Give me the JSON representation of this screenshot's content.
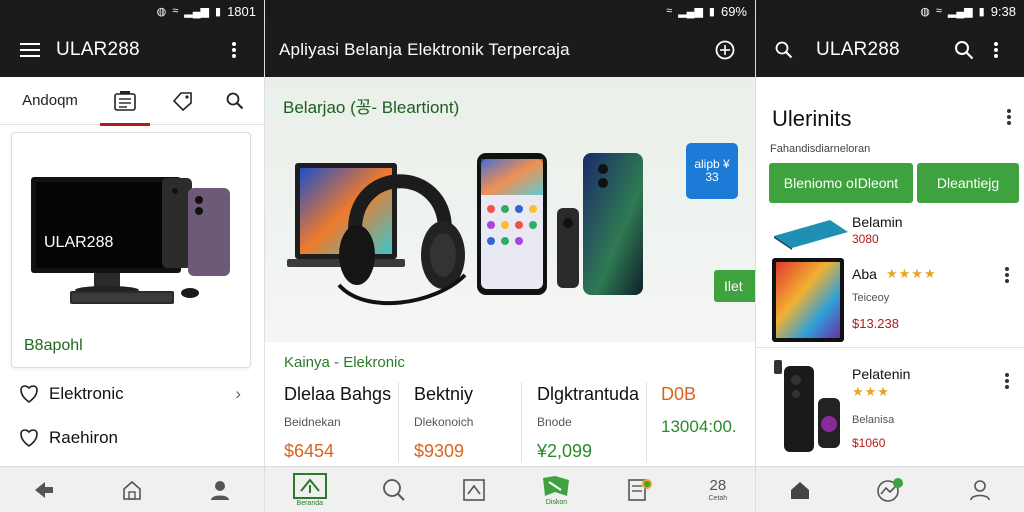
{
  "panel1": {
    "status": {
      "time": "1801"
    },
    "app_title": "ULAR288",
    "tabs": [
      "Andoqm"
    ],
    "card": {
      "screen_text": "ULAR288",
      "label": "B8apohl"
    },
    "list": [
      {
        "label": "Elektronic"
      },
      {
        "label": "Raehiron"
      }
    ]
  },
  "panel2": {
    "status": {
      "battery": "69%"
    },
    "app_title": "Apliyasi Belanja Elektronik Terpercaja",
    "banner": {
      "title": "Belarjao (꽁- Bleartiont)",
      "badge_text": "alipb ¥ 33",
      "cta_label": "Ilet"
    },
    "section": {
      "heading": "Kainya - Elekronic",
      "products": [
        {
          "name": "Dlelaa Bahgs",
          "category": "Beidnekan",
          "price": "$6454"
        },
        {
          "name": "Bektniy",
          "category": "Dlekonoich",
          "price": "$9309"
        },
        {
          "name": "Dlgktrantuda",
          "category": "Bnode",
          "price": "¥2,099"
        },
        {
          "name": "D0B",
          "category": "",
          "price": "13004:00."
        }
      ]
    },
    "nav": [
      {
        "caption": "Beranda"
      },
      {
        "caption": ""
      },
      {
        "caption": ""
      },
      {
        "caption": "Diskon"
      },
      {
        "caption": ""
      },
      {
        "caption": "Cetah"
      }
    ],
    "nav_icon_text": "28"
  },
  "panel3": {
    "status": {
      "time": "9:38"
    },
    "app_title": "ULAR288",
    "title": "Ulerinits",
    "subtitle": "Fahandisdiarneloran",
    "buttons": [
      "Bleniomo oIDleont",
      "Dleantiejg"
    ],
    "items": [
      {
        "name": "Belamin",
        "price": "3080"
      },
      {
        "name": "Aba",
        "desc": "Teiceoy",
        "price": "$13.238"
      },
      {
        "name": "Pelatenin",
        "desc": "Belanisa",
        "price": "$1060"
      }
    ]
  },
  "colors": {
    "accent_green": "#3ea33e",
    "accent_red": "#b31b1b",
    "appbar": "#1b1b1b"
  }
}
